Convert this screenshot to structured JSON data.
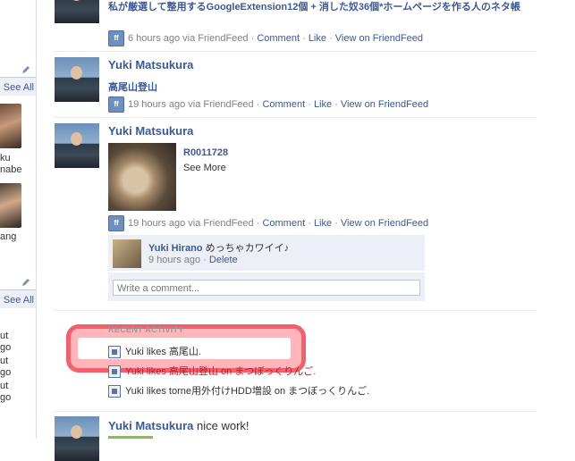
{
  "sidebar": {
    "see_all_1": "See All",
    "person_1_line1": "ku",
    "person_1_line2": "nabe",
    "person_2_line1": "ang",
    "see_all_2": "See All",
    "event_lines": [
      "ut",
      "go",
      "ut",
      "go",
      "ut",
      "go"
    ]
  },
  "stories": {
    "s1": {
      "message": "私が厳選して整用するGoogleExtension12個 + 消した奴36個*ホームページを作る人のネタ帳",
      "time": "6 hours ago via FriendFeed",
      "comment": "Comment",
      "like": "Like",
      "view": "View on FriendFeed"
    },
    "s2": {
      "name": "Yuki Matsukura",
      "link": "高尾山登山",
      "time": "19 hours ago via FriendFeed",
      "comment": "Comment",
      "like": "Like",
      "view": "View on FriendFeed"
    },
    "s3": {
      "name": "Yuki Matsukura",
      "photo_title": "R0011728",
      "see_more": "See More",
      "time": "19 hours ago via FriendFeed",
      "comment": "Comment",
      "like": "Like",
      "view": "View on FriendFeed",
      "reply": {
        "name": "Yuki Hirano",
        "text": "めっちゃカワイイ♪",
        "time": "9 hours ago",
        "delete": "Delete"
      },
      "comment_placeholder": "Write a comment..."
    },
    "recent": {
      "header": "RECENT ACTIVITY",
      "items": [
        "Yuki likes 高尾山.",
        "Yuki likes 高尾山登山 on まつぼっくりんご.",
        "Yuki likes torne用外付けHDD増設 on まつぼっくりんご."
      ]
    },
    "s4": {
      "name": "Yuki Matsukura",
      "message": "nice work!"
    }
  },
  "separator": "·",
  "colors": {
    "link": "#3b5998",
    "highlight": "#f2505f",
    "meta_gray": "#808080"
  }
}
